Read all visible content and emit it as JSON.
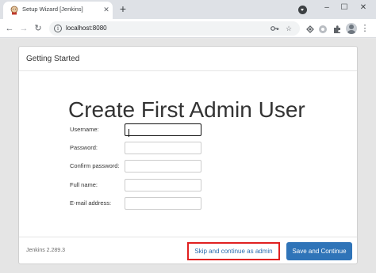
{
  "browser": {
    "tab_title": "Setup Wizard [Jenkins]",
    "close_glyph": "✕",
    "new_tab_glyph": "+",
    "url": "localhost:8080",
    "info_glyph": "i",
    "window_controls": {
      "minimize": "–",
      "maximize": "☐",
      "close": "✕"
    },
    "nav": {
      "back": "←",
      "forward": "→",
      "reload": "↻"
    },
    "icons": [
      "key-icon",
      "star-icon",
      "extension-icon",
      "puzzle-icon",
      "profile-icon",
      "menu-icon"
    ]
  },
  "dialog": {
    "header_title": "Getting Started",
    "heading": "Create First Admin User",
    "fields": [
      {
        "label": "Username:",
        "value": ""
      },
      {
        "label": "Password:",
        "value": ""
      },
      {
        "label": "Confirm password:",
        "value": ""
      },
      {
        "label": "Full name:",
        "value": ""
      },
      {
        "label": "E-mail address:",
        "value": ""
      }
    ],
    "version": "Jenkins 2.289.3",
    "skip_button": "Skip and continue as admin",
    "save_button": "Save and Continue"
  },
  "colors": {
    "primary_button": "#2f74b8",
    "highlight_border": "#e02020",
    "link_text": "#2a6cb0"
  }
}
